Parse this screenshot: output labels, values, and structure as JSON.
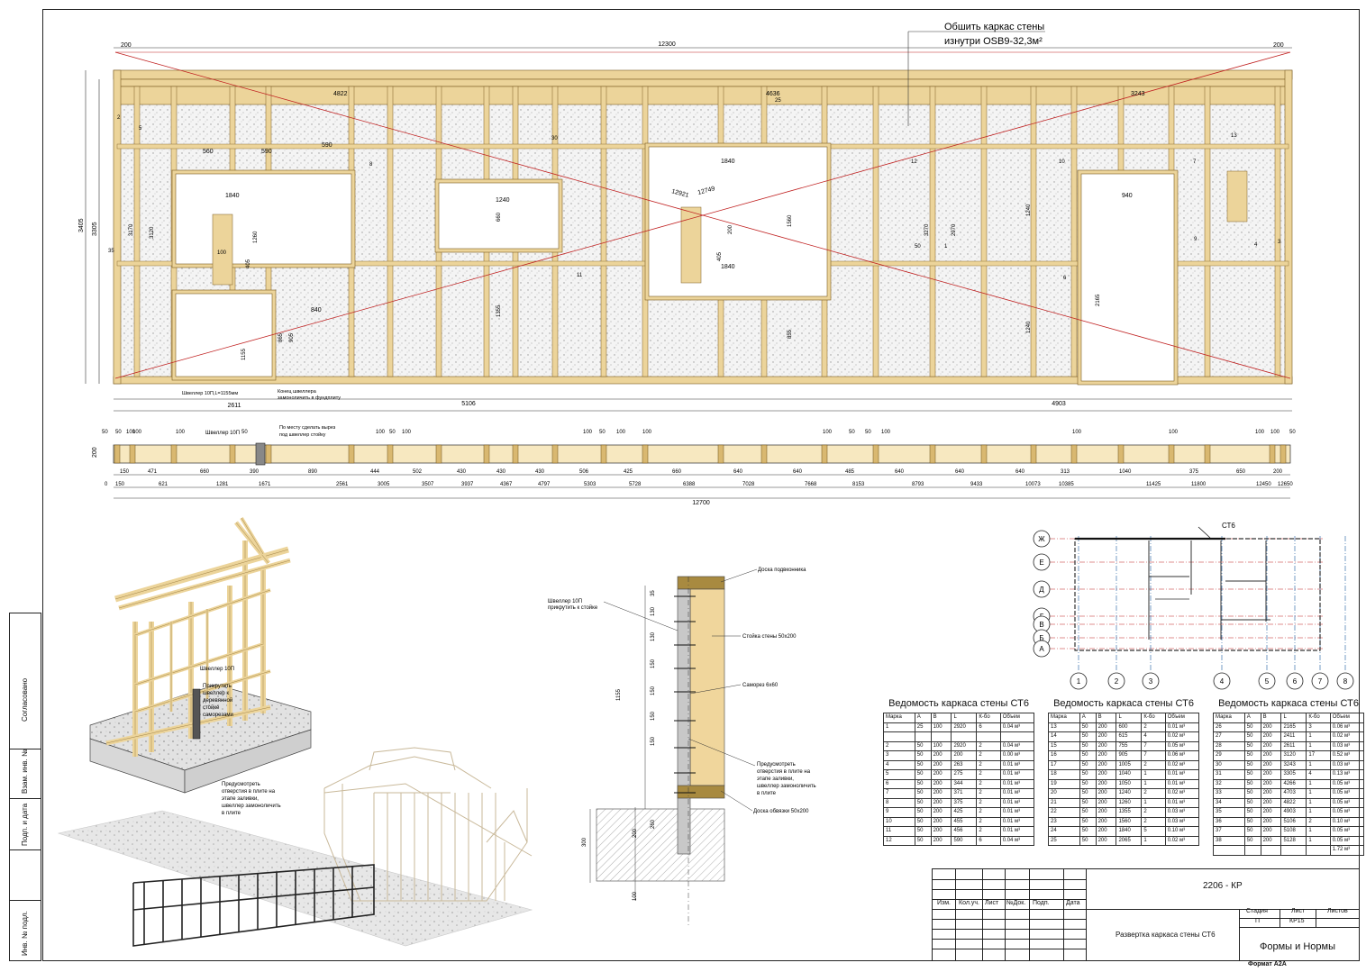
{
  "notes": {
    "sheathing_line1": "Обшить каркас стены",
    "sheathing_line2": "изнутри OSB9-32,3м²",
    "channel_label": "Швеллер 10П",
    "channel_label_len": "Швеллер 10П,L=1155мм",
    "channel_end_1": "Конец швеллера",
    "channel_end_2": "замоноличить в фундплиту",
    "cut_note_1": "По месту сделать вырез",
    "cut_note_2": "под швеллер стойку",
    "section_board_top": "Доска подвконника",
    "section_stud": "Стойка стены 50х200",
    "section_screw": "Саморез 6х60",
    "section_channel_1": "Швеллер 10П",
    "section_channel_2": "прикрутить к стойке",
    "section_holes_1": "Предусмотреть",
    "section_holes_2": "отверстия в плите на",
    "section_holes_3": "этапе заливки,",
    "section_holes_4": "швеллер замоноличить",
    "section_holes_5": "в плите",
    "section_board_bottom": "Доска обвязки 50х200",
    "iso_channel": "Швеллер 10П",
    "iso_note_1": "Прикрутить",
    "iso_note_2": "швеллер к",
    "iso_note_3": "деревянной",
    "iso_note_4": "стойке",
    "iso_note_5": "саморезами",
    "iso_holes_1": "Предусмотреть",
    "iso_holes_2": "отверстия в плите на",
    "iso_holes_3": "этапе заливки,",
    "iso_holes_4": "швеллер замоноличить",
    "iso_holes_5": "в плите"
  },
  "elevation": {
    "total_top": "12300",
    "total_bottom": "12700",
    "left_span": "5106",
    "right_span": "4903",
    "left_bottom": "2611",
    "height_total": "3405",
    "height_inner": "3305",
    "end_200": "200",
    "dims_top": [
      "4822",
      "4636",
      "3243"
    ],
    "diag_1": "12921",
    "diag_2": "12749",
    "labels_open": [
      "1840",
      "1840",
      "1840",
      "1240",
      "940",
      "840",
      "560",
      "590",
      "590"
    ],
    "heights": [
      "3170",
      "3120",
      "1260",
      "1155",
      "905",
      "865",
      "2970",
      "3270",
      "1240",
      "1240",
      "1560",
      "2165",
      "660",
      "1355",
      "855",
      "405",
      "405",
      "200",
      "100",
      "50",
      "35",
      "30",
      "25",
      "13",
      "12",
      "11",
      "10",
      "9",
      "8",
      "7",
      "6",
      "5",
      "4",
      "3",
      "2",
      "1"
    ]
  },
  "plan": {
    "marks": [
      "50",
      "100",
      "150",
      "200"
    ],
    "row1": [
      "150",
      "471",
      "660",
      "390",
      "890",
      "444",
      "502",
      "430",
      "430",
      "430",
      "506",
      "425",
      "660",
      "640",
      "640",
      "485",
      "640",
      "640",
      "640",
      "313",
      "1040",
      "375",
      "650",
      "200"
    ],
    "row2": [
      "0",
      "150",
      "621",
      "1281",
      "1671",
      "2561",
      "3005",
      "3507",
      "3937",
      "4367",
      "4797",
      "5303",
      "5728",
      "6388",
      "7028",
      "7668",
      "8153",
      "8793",
      "9433",
      "10073",
      "10385",
      "11425",
      "11800",
      "12450",
      "12650"
    ],
    "marker": "200",
    "sum": "12700"
  },
  "section": {
    "dims": [
      "35",
      "130",
      "130",
      "150",
      "150",
      "150",
      "150",
      "1155",
      "260",
      "200",
      "300",
      "100"
    ]
  },
  "key_plan": {
    "tag": "СТ6",
    "rows": [
      "Ж",
      "Е",
      "Д",
      "Г",
      "В",
      "Б",
      "А"
    ],
    "cols": [
      "1",
      "2",
      "3",
      "4",
      "5",
      "6",
      "7",
      "8"
    ]
  },
  "schedules": [
    {
      "title": "Ведомость каркаса стены СТ6",
      "headers": [
        "Марка",
        "A",
        "B",
        "L",
        "К-бо",
        "Объем"
      ],
      "rows": [
        [
          "1",
          "25",
          "100",
          "2920",
          "6",
          "0.04 м³"
        ],
        [
          "",
          "",
          "",
          "",
          "",
          ""
        ],
        [
          "2",
          "50",
          "100",
          "2920",
          "2",
          "0.04 м³"
        ],
        [
          "3",
          "50",
          "200",
          "200",
          "2",
          "0.00 м³"
        ],
        [
          "4",
          "50",
          "200",
          "263",
          "2",
          "0.01 м³"
        ],
        [
          "5",
          "50",
          "200",
          "275",
          "2",
          "0.01 м³"
        ],
        [
          "6",
          "50",
          "200",
          "344",
          "2",
          "0.01 м³"
        ],
        [
          "7",
          "50",
          "200",
          "371",
          "2",
          "0.01 м³"
        ],
        [
          "8",
          "50",
          "200",
          "375",
          "2",
          "0.01 м³"
        ],
        [
          "9",
          "50",
          "200",
          "425",
          "2",
          "0.01 м³"
        ],
        [
          "10",
          "50",
          "200",
          "455",
          "2",
          "0.01 м³"
        ],
        [
          "11",
          "50",
          "200",
          "456",
          "2",
          "0.01 м³"
        ],
        [
          "12",
          "50",
          "200",
          "590",
          "6",
          "0.04 м³"
        ]
      ]
    },
    {
      "title": "Ведомость каркаса стены СТ6",
      "headers": [
        "Марка",
        "A",
        "B",
        "L",
        "К-бо",
        "Объем"
      ],
      "rows": [
        [
          "13",
          "50",
          "200",
          "600",
          "2",
          "0.01 м³"
        ],
        [
          "14",
          "50",
          "200",
          "615",
          "4",
          "0.02 м³"
        ],
        [
          "15",
          "50",
          "200",
          "755",
          "7",
          "0.05 м³"
        ],
        [
          "16",
          "50",
          "200",
          "905",
          "7",
          "0.06 м³"
        ],
        [
          "17",
          "50",
          "200",
          "1005",
          "2",
          "0.02 м³"
        ],
        [
          "18",
          "50",
          "200",
          "1040",
          "1",
          "0.01 м³"
        ],
        [
          "19",
          "50",
          "200",
          "1050",
          "1",
          "0.01 м³"
        ],
        [
          "20",
          "50",
          "200",
          "1240",
          "2",
          "0.02 м³"
        ],
        [
          "21",
          "50",
          "200",
          "1260",
          "1",
          "0.01 м³"
        ],
        [
          "22",
          "50",
          "200",
          "1355",
          "2",
          "0.03 м³"
        ],
        [
          "23",
          "50",
          "200",
          "1560",
          "2",
          "0.03 м³"
        ],
        [
          "24",
          "50",
          "200",
          "1840",
          "5",
          "0.10 м³"
        ],
        [
          "25",
          "50",
          "200",
          "2065",
          "1",
          "0.02 м³"
        ]
      ]
    },
    {
      "title": "Ведомость каркаса стены СТ6",
      "headers": [
        "Марка",
        "A",
        "B",
        "L",
        "К-бо",
        "Объем"
      ],
      "rows": [
        [
          "26",
          "50",
          "200",
          "2165",
          "3",
          "0.06 м³"
        ],
        [
          "27",
          "50",
          "200",
          "2411",
          "1",
          "0.02 м³"
        ],
        [
          "28",
          "50",
          "200",
          "2611",
          "1",
          "0.03 м³"
        ],
        [
          "29",
          "50",
          "200",
          "3120",
          "17",
          "0.52 м³"
        ],
        [
          "30",
          "50",
          "200",
          "3243",
          "1",
          "0.03 м³"
        ],
        [
          "31",
          "50",
          "200",
          "3305",
          "4",
          "0.13 м³"
        ],
        [
          "32",
          "50",
          "200",
          "4266",
          "1",
          "0.05 м³"
        ],
        [
          "33",
          "50",
          "200",
          "4703",
          "1",
          "0.05 м³"
        ],
        [
          "34",
          "50",
          "200",
          "4822",
          "1",
          "0.05 м³"
        ],
        [
          "35",
          "50",
          "200",
          "4903",
          "1",
          "0.05 м³"
        ],
        [
          "36",
          "50",
          "200",
          "5106",
          "2",
          "0.10 м³"
        ],
        [
          "37",
          "50",
          "200",
          "5108",
          "1",
          "0.05 м³"
        ],
        [
          "38",
          "50",
          "200",
          "5128",
          "1",
          "0.05 м³"
        ],
        [
          "",
          "",
          "",
          "",
          "",
          "1.72 м³"
        ]
      ]
    }
  ],
  "title_block": {
    "code": "2206 - КР",
    "sheet_title": "Развертка каркаса стены СТ6",
    "org": "Формы и Нормы",
    "stage_label": "Стадия",
    "sheet_label": "Лист",
    "sheets_label": "Листов",
    "stage": "П",
    "sheet": "КР15",
    "cols": [
      "Изм.",
      "Кол.уч.",
      "Лист",
      "№Док.",
      "Подп.",
      "Дата"
    ],
    "format": "Формат А2А"
  },
  "sidebar": {
    "agreed": "Согласовано",
    "inv_replace": "Взам. инв. №",
    "sign_date": "Подп. и дата",
    "inv_orig": "Инв. № подл."
  }
}
